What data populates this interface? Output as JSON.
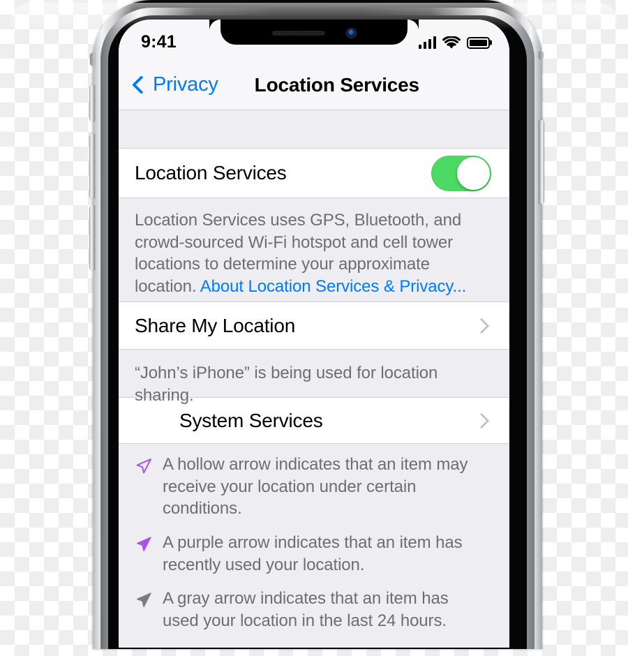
{
  "status_bar": {
    "time": "9:41",
    "cellular_icon": "signal-bars-icon",
    "wifi_icon": "wifi-icon",
    "battery_icon": "battery-full-icon"
  },
  "nav_bar": {
    "back_label": "Privacy",
    "back_icon": "chevron-left-icon",
    "title": "Location Services"
  },
  "colors": {
    "accent_blue": "#007aff",
    "toggle_green": "#4cd964",
    "arrow_purple": "#a855e8",
    "arrow_gray": "#7c7c80",
    "secondary_text": "#6d6d72",
    "group_background": "#eeeef2"
  },
  "sections": {
    "location_services": {
      "label": "Location Services",
      "toggle_state": "on",
      "footer_text": "Location Services uses GPS, Bluetooth, and crowd-sourced Wi-Fi hotspot and cell tower locations to determine your approximate location. ",
      "footer_link": "About Location Services & Privacy..."
    },
    "share_my_location": {
      "label": "Share My Location",
      "disclosure_icon": "chevron-right-icon",
      "footer_text": "“John’s iPhone” is being used for location sharing."
    },
    "system_services": {
      "label": "System Services",
      "disclosure_icon": "chevron-right-icon"
    }
  },
  "legend": [
    {
      "icon": "hollow-purple-arrow-icon",
      "text": "A hollow arrow indicates that an item may receive your location under certain conditions."
    },
    {
      "icon": "filled-purple-arrow-icon",
      "text": "A purple arrow indicates that an item has recently used your location."
    },
    {
      "icon": "filled-gray-arrow-icon",
      "text": "A gray arrow indicates that an item has used your location in the last 24 hours."
    }
  ]
}
